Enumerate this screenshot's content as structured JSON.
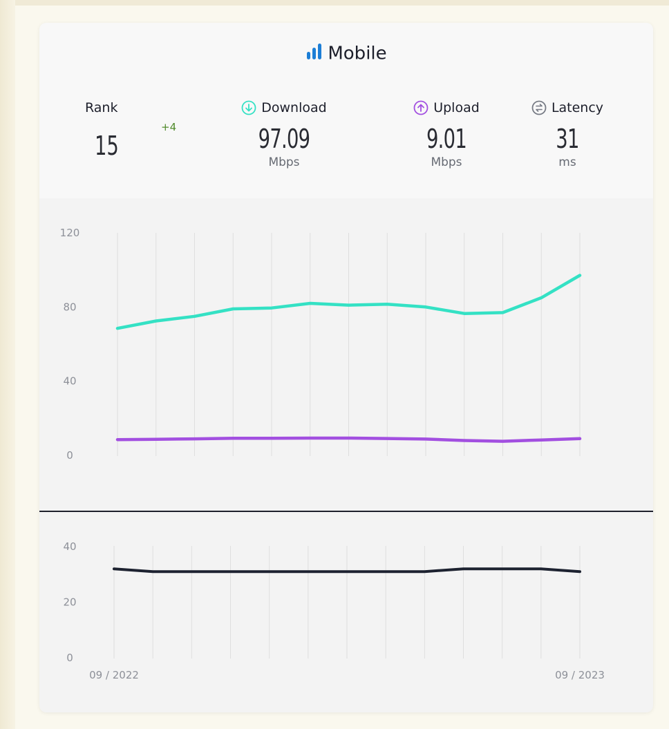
{
  "header": {
    "title": "Mobile",
    "rank": {
      "label": "Rank",
      "value": "15",
      "delta": "+4"
    },
    "download": {
      "label": "Download",
      "value": "97.09",
      "unit": "Mbps"
    },
    "upload": {
      "label": "Upload",
      "value": "9.01",
      "unit": "Mbps"
    },
    "latency": {
      "label": "Latency",
      "value": "31",
      "unit": "ms"
    }
  },
  "colors": {
    "download": "#34e1c4",
    "upload": "#a24fe0",
    "latency": "#1d2230",
    "title_icon": "#1c7ed6",
    "rank_delta": "#4f8a2a"
  },
  "icons": {
    "title": "signal-bars-icon",
    "download": "arrow-down-circle-icon",
    "upload": "arrow-up-circle-icon",
    "latency": "latency-arrows-circle-icon"
  },
  "chart_data": [
    {
      "type": "line",
      "ylim": [
        0,
        120
      ],
      "yticks": [
        "120",
        "80",
        "40",
        "0"
      ],
      "ytick_values": [
        120,
        80,
        40,
        0
      ],
      "x": [
        1,
        2,
        3,
        4,
        5,
        6,
        7,
        8,
        9,
        10,
        11,
        12,
        13
      ],
      "series": [
        {
          "key": "download",
          "values": [
            68.5,
            72.5,
            75,
            79,
            79.5,
            82,
            81,
            81.5,
            80,
            76.5,
            77,
            85,
            97.09
          ]
        },
        {
          "key": "upload",
          "values": [
            8.5,
            8.7,
            8.9,
            9.2,
            9.2,
            9.3,
            9.3,
            9.1,
            8.8,
            8.0,
            7.6,
            8.3,
            9.01
          ]
        }
      ],
      "grid": "vertical"
    },
    {
      "type": "line",
      "ylim": [
        0,
        40
      ],
      "yticks": [
        "40",
        "20",
        "0"
      ],
      "ytick_values": [
        40,
        20,
        0
      ],
      "x": [
        1,
        2,
        3,
        4,
        5,
        6,
        7,
        8,
        9,
        10,
        11,
        12,
        13
      ],
      "xtick_labels": [
        "09 / 2022",
        "09 / 2023"
      ],
      "series": [
        {
          "key": "latency",
          "values": [
            32,
            31,
            31,
            31,
            31,
            31,
            31,
            31,
            31,
            32,
            32,
            32,
            31
          ]
        }
      ],
      "grid": "vertical"
    }
  ]
}
